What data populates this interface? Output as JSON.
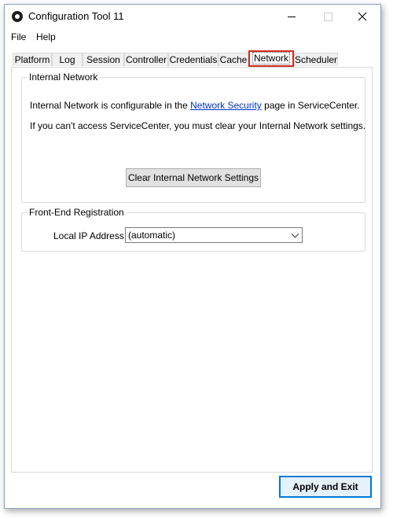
{
  "window": {
    "title": "Configuration Tool 11",
    "icons": {
      "app": "app-logo-icon",
      "minimize": "minimize-icon",
      "maximize": "maximize-icon",
      "close": "close-icon"
    }
  },
  "menu": {
    "file": "File",
    "help": "Help"
  },
  "tabs": [
    {
      "label": "Platform"
    },
    {
      "label": "Log"
    },
    {
      "label": "Session"
    },
    {
      "label": "Controller"
    },
    {
      "label": "Credentials"
    },
    {
      "label": "Cache"
    },
    {
      "label": "Network",
      "active": true,
      "highlight_color": "#d42a1f"
    },
    {
      "label": "Scheduler"
    }
  ],
  "internal_network": {
    "legend": "Internal Network",
    "line1_prefix": "Internal Network is configurable in the ",
    "line1_link": "Network Security",
    "line1_suffix": " page in ServiceCenter.",
    "line2": "If you can't access ServiceCenter, you must clear your Internal Network settings.",
    "clear_button": "Clear Internal Network Settings"
  },
  "frontend": {
    "legend": "Front-End Registration",
    "ip_label": "Local IP Address",
    "ip_value": "(automatic)"
  },
  "footer": {
    "apply_button": "Apply and Exit"
  },
  "colors": {
    "link": "#0033cc",
    "accent": "#0078d7",
    "tab_highlight": "#d42a1f"
  }
}
